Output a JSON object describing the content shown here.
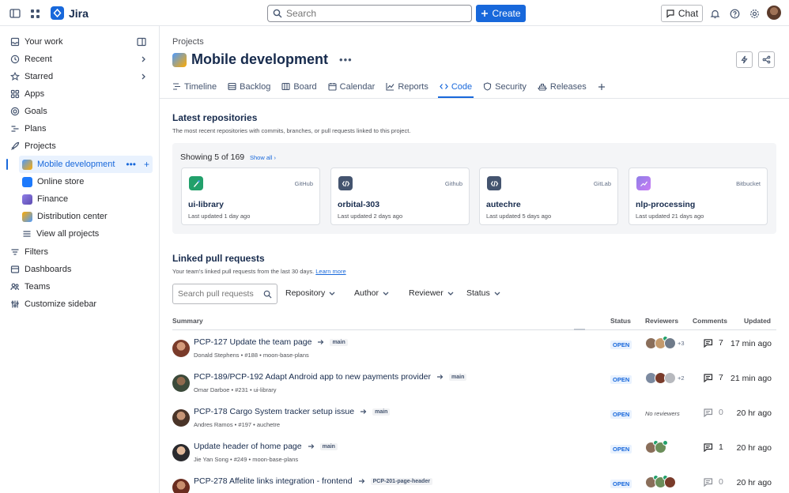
{
  "topbar": {
    "app_name": "Jira",
    "search_placeholder": "Search",
    "create_label": "Create",
    "chat_label": "Chat"
  },
  "sidebar": {
    "items": [
      {
        "label": "Your work",
        "icon": "inbox-icon"
      },
      {
        "label": "Recent",
        "icon": "clock-icon"
      },
      {
        "label": "Starred",
        "icon": "star-icon"
      },
      {
        "label": "Apps",
        "icon": "apps-icon"
      },
      {
        "label": "Goals",
        "icon": "goal-icon"
      },
      {
        "label": "Plans",
        "icon": "plans-icon"
      },
      {
        "label": "Projects",
        "icon": "rocket-icon"
      }
    ],
    "projects": [
      {
        "label": "Mobile development",
        "color": "#4c9aff"
      },
      {
        "label": "Online store",
        "color": "#1d7afc"
      },
      {
        "label": "Finance",
        "color": "#8f7ee7"
      },
      {
        "label": "Distribution center",
        "color": "#ffab00"
      }
    ],
    "view_all": "View all projects",
    "bottom": [
      {
        "label": "Filters",
        "icon": "filter-icon"
      },
      {
        "label": "Dashboards",
        "icon": "dashboard-icon"
      },
      {
        "label": "Teams",
        "icon": "people-icon"
      },
      {
        "label": "Customize sidebar",
        "icon": "customize-icon"
      }
    ]
  },
  "page": {
    "breadcrumb": "Projects",
    "title": "Mobile development",
    "tabs": [
      "Timeline",
      "Backlog",
      "Board",
      "Calendar",
      "Reports",
      "Code",
      "Security",
      "Releases"
    ],
    "active_tab": "Code"
  },
  "repos": {
    "heading": "Latest repositories",
    "description": "The most recent repositories with commits, branches, or pull requests linked to this project.",
    "showing": "Showing 5 of 169",
    "show_all": "Show all",
    "cards": [
      {
        "name": "ui-library",
        "host": "GitHub",
        "updated": "Last updated 1 day ago",
        "icon_bg": "#22a06b"
      },
      {
        "name": "orbital-303",
        "host": "Github",
        "updated": "Last updated 2 days ago",
        "icon_bg": "#44546f"
      },
      {
        "name": "autechre",
        "host": "GitLab",
        "updated": "Last updated 5 days ago",
        "icon_bg": "#44546f"
      },
      {
        "name": "nlp-processing",
        "host": "Bitbucket",
        "updated": "Last updated 21 days ago",
        "icon_bg": "#8f7ee7"
      }
    ]
  },
  "prs": {
    "heading": "Linked pull requests",
    "description": "Your team's linked pull requests from the last 30 days.",
    "learn_more": "Learn more",
    "search_placeholder": "Search pull requests",
    "filters": [
      "Repository",
      "Author",
      "Reviewer",
      "Status"
    ],
    "columns": {
      "summary": "Summary",
      "status": "Status",
      "reviewers": "Reviewers",
      "comments": "Comments",
      "updated": "Updated"
    },
    "rows": [
      {
        "title": "PCP-127 Update the team page",
        "branch": "main",
        "meta": "Donald Stephens • #188 • moon-base-plans",
        "status": "OPEN",
        "reviewers_more": "+3",
        "no_reviewers": "",
        "comments": "7",
        "updated": "17 min ago"
      },
      {
        "title": "PCP-189/PCP-192 Adapt Android app to new payments provider",
        "branch": "main",
        "meta": "Omar Darboe • #231 • ui-library",
        "status": "OPEN",
        "reviewers_more": "+2",
        "no_reviewers": "",
        "comments": "7",
        "updated": "21 min ago"
      },
      {
        "title": "PCP-178 Cargo System tracker setup issue",
        "branch": "main",
        "meta": "Andres Ramos • #197 • auchetre",
        "status": "OPEN",
        "reviewers_more": "",
        "no_reviewers": "No reviewers",
        "comments": "0",
        "updated": "20 hr ago"
      },
      {
        "title": "Update header of home page",
        "branch": "main",
        "meta": "Jie Yan Song • #249 • moon-base-plans",
        "status": "OPEN",
        "reviewers_more": "",
        "no_reviewers": "",
        "comments": "1",
        "updated": "20 hr ago"
      },
      {
        "title": "PCP-278 Affelite links integration - frontend",
        "branch": "PCP-201-page-header",
        "meta": "",
        "status": "OPEN",
        "reviewers_more": "",
        "no_reviewers": "",
        "comments": "0",
        "updated": "20 hr ago"
      }
    ]
  },
  "colors": {
    "accent": "#1868db",
    "text": "#172b4d",
    "success": "#22a06b"
  }
}
